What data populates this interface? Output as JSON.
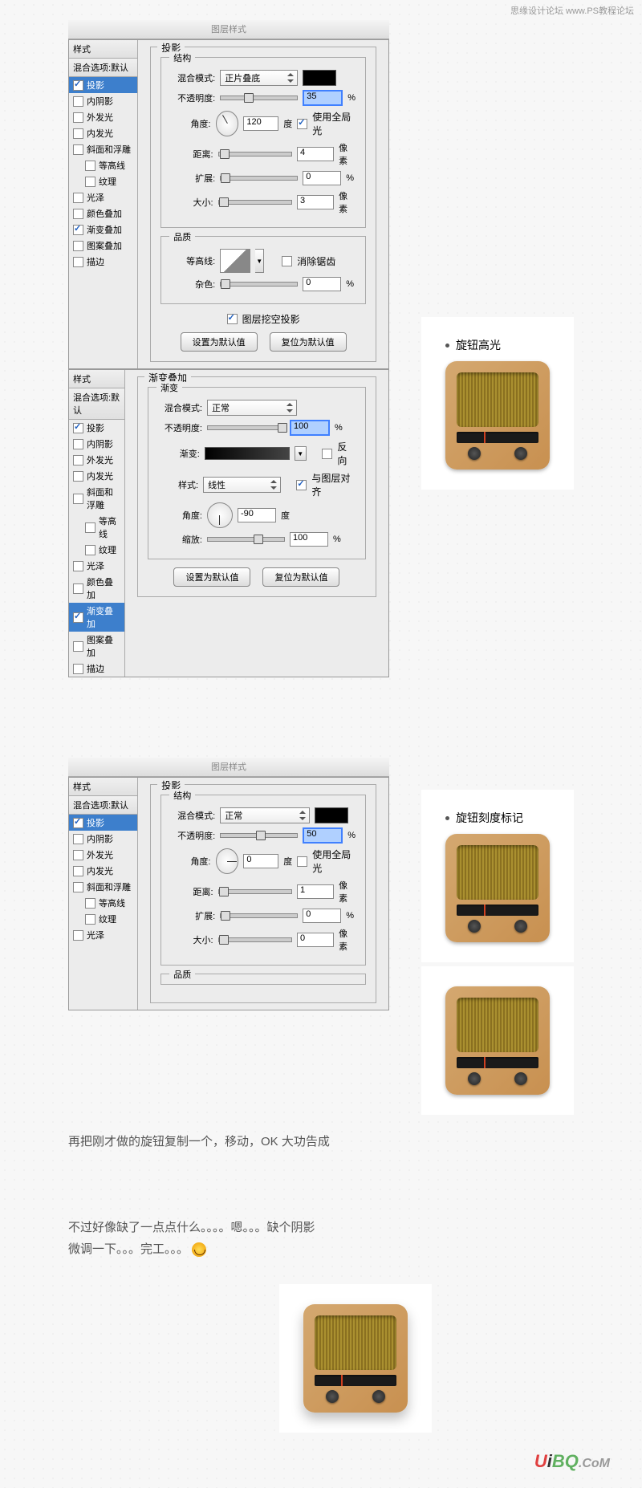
{
  "watermark": "思缘设计论坛 www.PS教程论坛",
  "panel1": {
    "topbar": "图层样式",
    "styles_header": "样式",
    "blend_default": "混合选项:默认",
    "items": [
      {
        "label": "投影",
        "checked": true,
        "selected": true
      },
      {
        "label": "内阴影",
        "checked": false
      },
      {
        "label": "外发光",
        "checked": false
      },
      {
        "label": "内发光",
        "checked": false
      },
      {
        "label": "斜面和浮雕",
        "checked": false
      },
      {
        "label": "等高线",
        "checked": false,
        "indent": true
      },
      {
        "label": "纹理",
        "checked": false,
        "indent": true
      },
      {
        "label": "光泽",
        "checked": false
      },
      {
        "label": "颜色叠加",
        "checked": false
      },
      {
        "label": "渐变叠加",
        "checked": true
      },
      {
        "label": "图案叠加",
        "checked": false
      },
      {
        "label": "描边",
        "checked": false
      }
    ],
    "group_outer": "投影",
    "group_struct": "结构",
    "blend_mode_lbl": "混合模式:",
    "blend_mode_val": "正片叠底",
    "opacity_lbl": "不透明度:",
    "opacity_val": "35",
    "opacity_unit": "%",
    "angle_lbl": "角度:",
    "angle_val": "120",
    "angle_unit": "度",
    "global_light_lbl": "使用全局光",
    "distance_lbl": "距离:",
    "distance_val": "4",
    "distance_unit": "像素",
    "spread_lbl": "扩展:",
    "spread_val": "0",
    "spread_unit": "%",
    "size_lbl": "大小:",
    "size_val": "3",
    "size_unit": "像素",
    "group_quality": "品质",
    "contour_lbl": "等高线:",
    "antialias_lbl": "消除锯齿",
    "noise_lbl": "杂色:",
    "noise_val": "0",
    "noise_unit": "%",
    "knockout_lbl": "图层挖空投影",
    "btn_default": "设置为默认值",
    "btn_reset": "复位为默认值"
  },
  "panel2": {
    "styles_header": "样式",
    "blend_default": "混合选项:默认",
    "items": [
      {
        "label": "投影",
        "checked": true
      },
      {
        "label": "内阴影",
        "checked": false
      },
      {
        "label": "外发光",
        "checked": false
      },
      {
        "label": "内发光",
        "checked": false
      },
      {
        "label": "斜面和浮雕",
        "checked": false
      },
      {
        "label": "等高线",
        "checked": false,
        "indent": true
      },
      {
        "label": "纹理",
        "checked": false,
        "indent": true
      },
      {
        "label": "光泽",
        "checked": false
      },
      {
        "label": "颜色叠加",
        "checked": false
      },
      {
        "label": "渐变叠加",
        "checked": true,
        "selected": true
      },
      {
        "label": "图案叠加",
        "checked": false
      },
      {
        "label": "描边",
        "checked": false
      }
    ],
    "group_outer": "渐变叠加",
    "group_grad": "渐变",
    "blend_mode_lbl": "混合模式:",
    "blend_mode_val": "正常",
    "opacity_lbl": "不透明度:",
    "opacity_val": "100",
    "opacity_unit": "%",
    "gradient_lbl": "渐变:",
    "reverse_lbl": "反向",
    "style_lbl": "样式:",
    "style_val": "线性",
    "align_lbl": "与图层对齐",
    "angle_lbl": "角度:",
    "angle_val": "-90",
    "angle_unit": "度",
    "scale_lbl": "缩放:",
    "scale_val": "100",
    "scale_unit": "%",
    "btn_default": "设置为默认值",
    "btn_reset": "复位为默认值"
  },
  "panel3": {
    "topbar": "图层样式",
    "styles_header": "样式",
    "blend_default": "混合选项:默认",
    "items": [
      {
        "label": "投影",
        "checked": true,
        "selected": true
      },
      {
        "label": "内阴影",
        "checked": false
      },
      {
        "label": "外发光",
        "checked": false
      },
      {
        "label": "内发光",
        "checked": false
      },
      {
        "label": "斜面和浮雕",
        "checked": false
      },
      {
        "label": "等高线",
        "checked": false,
        "indent": true
      },
      {
        "label": "纹理",
        "checked": false,
        "indent": true
      },
      {
        "label": "光泽",
        "checked": false
      }
    ],
    "group_outer": "投影",
    "group_struct": "结构",
    "blend_mode_lbl": "混合模式:",
    "blend_mode_val": "正常",
    "opacity_lbl": "不透明度:",
    "opacity_val": "50",
    "opacity_unit": "%",
    "angle_lbl": "角度:",
    "angle_val": "0",
    "angle_unit": "度",
    "global_light_lbl": "使用全局光",
    "distance_lbl": "距离:",
    "distance_val": "1",
    "distance_unit": "像素",
    "spread_lbl": "扩展:",
    "spread_val": "0",
    "spread_unit": "%",
    "size_lbl": "大小:",
    "size_val": "0",
    "size_unit": "像素",
    "group_quality": "品质"
  },
  "captions": {
    "c1": "旋钮高光",
    "c2": "旋钮刻度标记"
  },
  "text": {
    "p1": "再把刚才做的旋钮复制一个，移动，OK  大功告成",
    "p2": "不过好像缺了一点点什么。。。。嗯。。。缺个阴影",
    "p3": "微调一下。。。完工。。。"
  },
  "footer": {
    "u": "U",
    "i": "i",
    "bq": "BQ",
    "com": ".CoM"
  }
}
